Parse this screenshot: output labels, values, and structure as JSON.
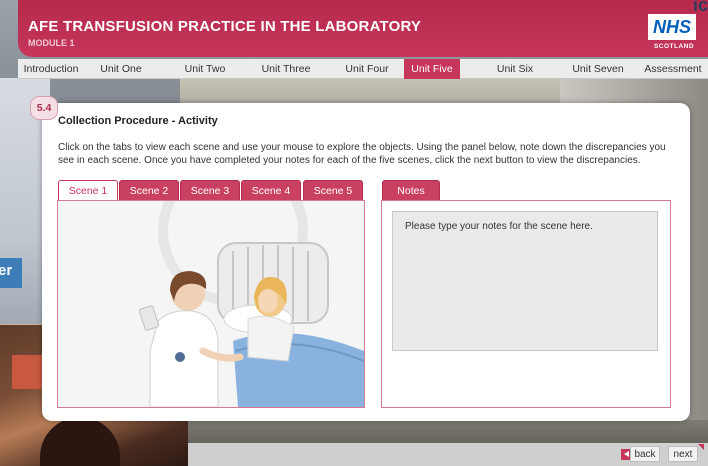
{
  "header": {
    "title": "AFE TRANSFUSION PRACTICE IN THE LABORATORY",
    "module": "MODULE 1",
    "logo_text": "NHS",
    "logo_sub": "SCOTLAND",
    "corner_text": "ic"
  },
  "nav": {
    "items": [
      {
        "label": "Introduction"
      },
      {
        "label": "Unit One"
      },
      {
        "label": "Unit Two"
      },
      {
        "label": "Unit Three"
      },
      {
        "label": "Unit Four"
      },
      {
        "label": "Unit Five"
      },
      {
        "label": "Unit Six"
      },
      {
        "label": "Unit Seven"
      },
      {
        "label": "Assessment"
      }
    ],
    "active": "Unit Five"
  },
  "background": {
    "left_button_text": "er"
  },
  "panel": {
    "badge": "5.4",
    "title": "Collection Procedure - Activity",
    "instructions": "Click on the tabs to view each scene and use your mouse to explore the objects. Using the panel below, note down the discrepancies you see in each scene. Once you have completed your notes for each of the five scenes, click the next button to view the discrepancies.",
    "scene_tabs": [
      {
        "label": "Scene 1"
      },
      {
        "label": "Scene 2"
      },
      {
        "label": "Scene 3"
      },
      {
        "label": "Scene 4"
      },
      {
        "label": "Scene 5"
      }
    ],
    "active_scene": "Scene 1",
    "notes_tab": "Notes",
    "notes_placeholder": "Please type your notes for the scene here.",
    "notes_value": ""
  },
  "footer": {
    "back_label": "back",
    "next_label": "next"
  },
  "colors": {
    "brand": "#c5365a",
    "nav_bg": "#ececec",
    "nhs_blue": "#005eb8"
  }
}
